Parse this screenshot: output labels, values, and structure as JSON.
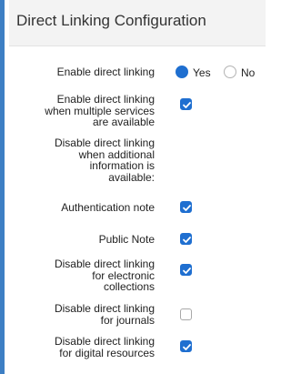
{
  "panel": {
    "title": "Direct Linking Configuration"
  },
  "colors": {
    "accent": "#1f6fd0",
    "sidebar_border": "#3d7fc4"
  },
  "fields": {
    "enable_direct_linking": {
      "label": "Enable direct linking",
      "options": [
        {
          "label": "Yes",
          "selected": true
        },
        {
          "label": "No",
          "selected": false
        }
      ]
    },
    "multiple_services": {
      "label": [
        "Enable direct linking",
        "when multiple services",
        "are available"
      ],
      "checked": true
    },
    "additional_info": {
      "label": [
        "Disable direct linking",
        "when additional",
        "information is",
        "available:"
      ]
    },
    "authentication_note": {
      "label": "Authentication note",
      "checked": true
    },
    "public_note": {
      "label": "Public Note",
      "checked": true
    },
    "electronic_collections": {
      "label": [
        "Disable direct linking",
        "for electronic",
        "collections"
      ],
      "checked": true
    },
    "journals": {
      "label": [
        "Disable direct linking",
        "for journals"
      ],
      "checked": false
    },
    "digital_resources": {
      "label": [
        "Disable direct linking",
        "for digital resources"
      ],
      "checked": true
    }
  }
}
